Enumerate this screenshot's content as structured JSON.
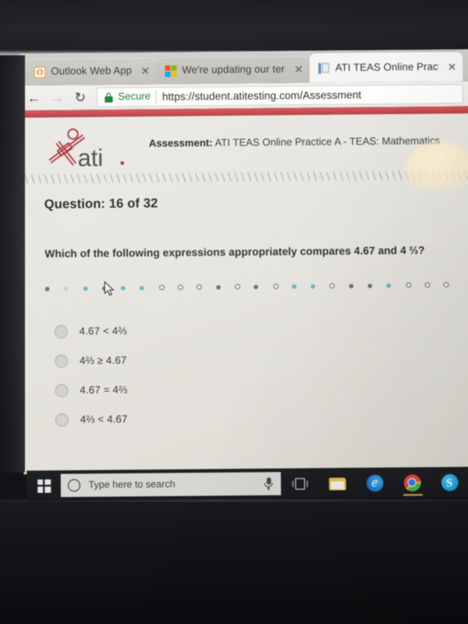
{
  "browser": {
    "tabs": [
      {
        "title": "Outlook Web App",
        "favicon": "outlook-icon",
        "close_label": "✕",
        "active": false
      },
      {
        "title": "We're updating our term",
        "favicon": "microsoft-icon",
        "close_label": "✕",
        "active": false
      },
      {
        "title": "ATI TEAS Online Practice",
        "favicon": "ati-page-icon",
        "close_label": "✕",
        "active": true
      }
    ],
    "nav": {
      "back_icon": "←",
      "forward_icon": "→",
      "reload_icon": "↻"
    },
    "omnibox": {
      "security_label": "Secure",
      "security_icon": "lock-icon",
      "url": "https://student.atitesting.com/Assessment"
    },
    "brand_bar_color": "#c6474b"
  },
  "assessment": {
    "logo_text": "ati",
    "logo_alt": "ati-logo",
    "header_label": "Assessment:",
    "header_value": "ATI TEAS Online Practice A - TEAS: Mathematics",
    "question_counter": "Question: 16 of 32",
    "question_text": "Which of the following expressions appropriately compares 4.67 and 4 ⅔?",
    "options": [
      {
        "text": "4.67 < 4⅔",
        "selected": false
      },
      {
        "text": "4⅔ ≥ 4.67",
        "selected": false
      },
      {
        "text": "4.67 = 4⅔",
        "selected": false
      },
      {
        "text": "4⅔ < 4.67",
        "selected": false
      }
    ],
    "nav_dots": [
      "filled-dark",
      "faint",
      "filled-teal",
      "filled-dark",
      "filled-teal",
      "filled-teal",
      "hollow",
      "hollow",
      "hollow",
      "filled-dark",
      "hollow",
      "filled-dark",
      "hollow",
      "filled-teal",
      "filled-teal",
      "hollow",
      "filled-dark",
      "filled-dark",
      "filled-teal",
      "hollow",
      "hollow",
      "hollow"
    ],
    "dot_colors": {
      "answered": "#63b3c6",
      "current": "#6c6f72",
      "unanswered": "#f0eee9"
    }
  },
  "taskbar": {
    "start_label": "start-button",
    "search_placeholder": "Type here to search",
    "cortana_icon": "cortana-circle-icon",
    "mic_icon": "microphone-icon",
    "task_view_icon": "task-view-icon",
    "pinned": [
      {
        "name": "file-explorer-icon",
        "label": "File Explorer"
      },
      {
        "name": "edge-icon",
        "label": "e"
      },
      {
        "name": "chrome-icon",
        "label": "Chrome"
      },
      {
        "name": "skype-icon",
        "label": "S"
      }
    ]
  }
}
